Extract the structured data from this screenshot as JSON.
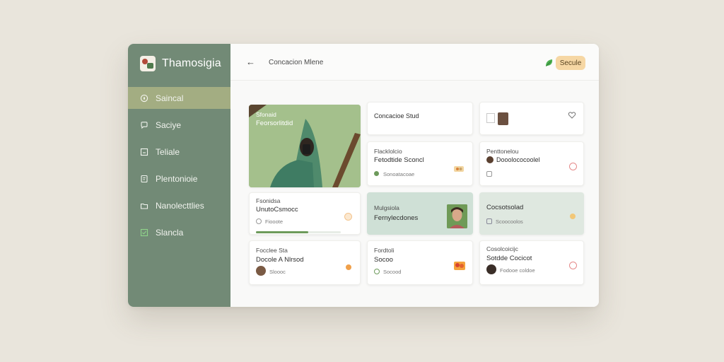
{
  "app": {
    "name": "Thamosigia"
  },
  "sidebar": {
    "items": [
      {
        "label": "Saincal",
        "icon": "compass-icon",
        "active": true
      },
      {
        "label": "Saciye",
        "icon": "chat-icon",
        "active": false
      },
      {
        "label": "Teliale",
        "icon": "checkbox-icon",
        "active": false
      },
      {
        "label": "Plentonioie",
        "icon": "document-icon",
        "active": false
      },
      {
        "label": "Nanolecttlies",
        "icon": "folder-icon",
        "active": false
      },
      {
        "label": "Slancla",
        "icon": "check-square-icon",
        "active": false
      }
    ]
  },
  "topbar": {
    "breadcrumb": "Concacion Mlene",
    "button_label": "Secule",
    "colors": {
      "button_bg": "#f6d7a4",
      "leaf": "#4caf50"
    }
  },
  "hero": {
    "kicker": "Sfonaid",
    "title": "Feorsorlitdid"
  },
  "cards": {
    "r1c2": {
      "title": "Concacioe Stud"
    },
    "r2c2": {
      "kicker": "Flacklolcio",
      "title": "Fetodtide Sconcl",
      "meta": "Sonoatacoae"
    },
    "r2c3": {
      "kicker": "Penttonelou",
      "title": "Dooolococoolel"
    },
    "r3c1": {
      "kicker": "Fsonidsa",
      "title": "UnutoCsmocc",
      "meta": "Fiooote",
      "progress": 0.62
    },
    "r3c2": {
      "kicker": "Mulgsiola",
      "title": "Fernylecdones"
    },
    "r3c3": {
      "title": "Cocsotsolad",
      "meta": "Scoocoolos"
    },
    "r4c1": {
      "kicker": "Focclee Sta",
      "title": "Docole A Nlrsod",
      "meta": "Sloooc"
    },
    "r4c2": {
      "kicker": "Fordtoli",
      "title": "Socoo",
      "meta": "Socood"
    },
    "r4c3": {
      "kicker": "Cosolcoicijc",
      "title": "Sotdde Cocicot",
      "meta": "Fodooe coldoe"
    }
  },
  "colors": {
    "sidebar": "#728a76",
    "active": "#a3ad82",
    "accent_orange": "#f0a04a",
    "accent_pink": "#e58a8a",
    "accent_green": "#6d9a5b"
  }
}
